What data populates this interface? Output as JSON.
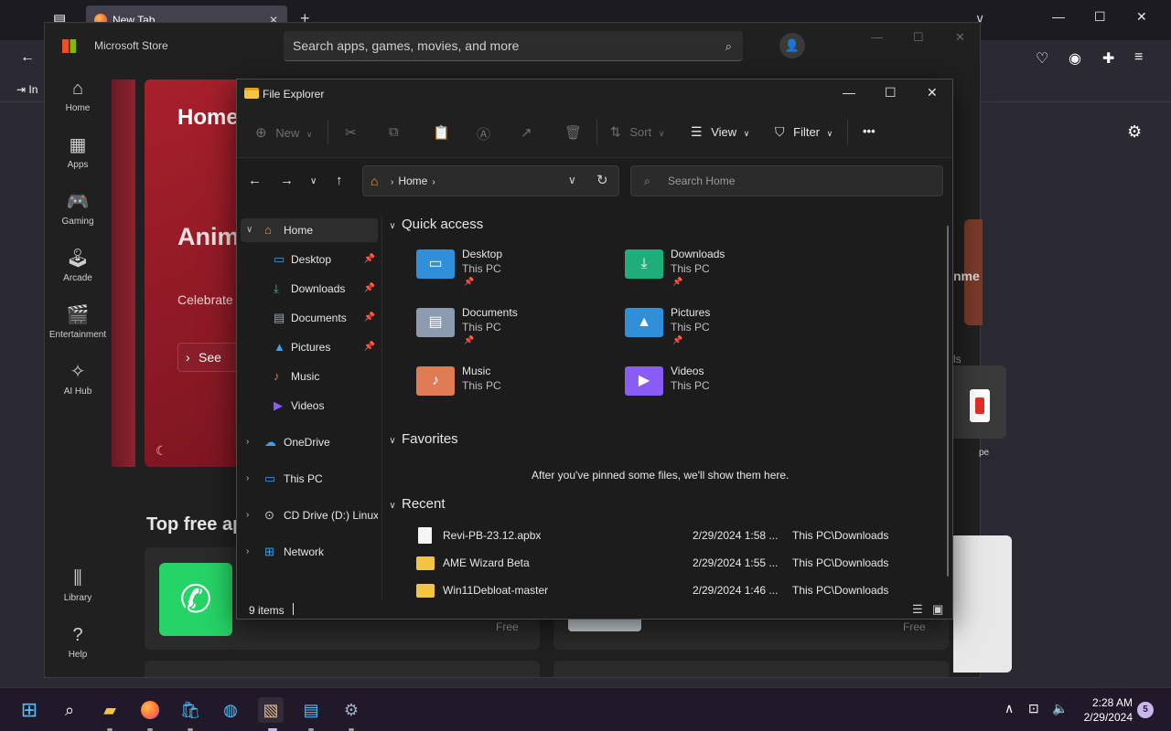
{
  "browser": {
    "tab_title": "New Tab",
    "tab_close": "✕",
    "new_tab": "+",
    "list_tabs": "∨",
    "minimize": "—",
    "maximize": "☐",
    "close": "✕",
    "back": "←",
    "bookmark_partial": "In"
  },
  "store": {
    "app_title": "Microsoft Store",
    "search_placeholder": "Search apps, games, movies, and more",
    "nav": [
      {
        "label": "Home",
        "icon": "⌂"
      },
      {
        "label": "Apps",
        "icon": "▦"
      },
      {
        "label": "Gaming",
        "icon": "🎮"
      },
      {
        "label": "Arcade",
        "icon": "🕹"
      },
      {
        "label": "Entertainment",
        "icon": "🎬"
      },
      {
        "label": "AI Hub",
        "icon": "✧"
      },
      {
        "label": "Library",
        "icon": "⫼"
      },
      {
        "label": "Help",
        "icon": "?"
      }
    ],
    "hero": {
      "title": "Home",
      "headline": "Anim up to",
      "subtitle": "Celebrate long",
      "button": "See"
    },
    "section_title": "Top free ap",
    "free_label": "Free",
    "right_partial_label": "nme",
    "right_partial_link": "ls",
    "right_partial_app": "pe"
  },
  "explorer": {
    "title": "File Explorer",
    "commands": {
      "new": "New",
      "sort": "Sort",
      "view": "View",
      "filter": "Filter",
      "more": "•••"
    },
    "address": {
      "crumb": "Home",
      "search_placeholder": "Search Home"
    },
    "sidebar": [
      {
        "label": "Home",
        "icon": "⌂",
        "color": "#e8a33a",
        "expand": "∨",
        "pinned": false
      },
      {
        "label": "Desktop",
        "icon": "▭",
        "color": "#3aa0e8",
        "expand": "",
        "pinned": true
      },
      {
        "label": "Downloads",
        "icon": "⤓",
        "color": "#2ec27e",
        "expand": "",
        "pinned": true
      },
      {
        "label": "Documents",
        "icon": "▤",
        "color": "#9aa7b8",
        "expand": "",
        "pinned": true
      },
      {
        "label": "Pictures",
        "icon": "▲",
        "color": "#3aa0e8",
        "expand": "",
        "pinned": true
      },
      {
        "label": "Music",
        "icon": "♪",
        "color": "#e8795a",
        "expand": "",
        "pinned": false
      },
      {
        "label": "Videos",
        "icon": "▶",
        "color": "#8a5cf6",
        "expand": "",
        "pinned": false
      },
      {
        "label": "OneDrive",
        "icon": "☁",
        "color": "#3aa0e8",
        "expand": "›",
        "pinned": false
      },
      {
        "label": "This PC",
        "icon": "▭",
        "color": "#3aa0e8",
        "expand": "›",
        "pinned": false
      },
      {
        "label": "CD Drive (D:) Linux L",
        "icon": "⊙",
        "color": "#cfcfcf",
        "expand": "›",
        "pinned": false
      },
      {
        "label": "Network",
        "icon": "⊞",
        "color": "#3aa0e8",
        "expand": "›",
        "pinned": false
      }
    ],
    "quick_access_title": "Quick access",
    "quick_access": [
      {
        "name": "Desktop",
        "sub": "This PC",
        "pinned": true,
        "color": "#2f8fd8",
        "glyph": "▭"
      },
      {
        "name": "Downloads",
        "sub": "This PC",
        "pinned": true,
        "color": "#1fae7a",
        "glyph": "⤓"
      },
      {
        "name": "Documents",
        "sub": "This PC",
        "pinned": true,
        "color": "#8c9bb0",
        "glyph": "▤"
      },
      {
        "name": "Pictures",
        "sub": "This PC",
        "pinned": true,
        "color": "#2f8fd8",
        "glyph": "▲"
      },
      {
        "name": "Music",
        "sub": "This PC",
        "pinned": false,
        "color": "#e07a55",
        "glyph": "♪"
      },
      {
        "name": "Videos",
        "sub": "This PC",
        "pinned": false,
        "color": "#8a5cf6",
        "glyph": "▶"
      }
    ],
    "favorites_title": "Favorites",
    "favorites_empty": "After you've pinned some files, we'll show them here.",
    "recent_title": "Recent",
    "recent": [
      {
        "name": "Revi-PB-23.12.apbx",
        "date": "2/29/2024 1:58 ...",
        "location": "This PC\\Downloads",
        "type": "file"
      },
      {
        "name": "AME Wizard Beta",
        "date": "2/29/2024 1:55 ...",
        "location": "This PC\\Downloads",
        "type": "folder"
      },
      {
        "name": "Win11Debloat-master",
        "date": "2/29/2024 1:46 ...",
        "location": "This PC\\Downloads",
        "type": "folder"
      }
    ],
    "status": {
      "items": "9 items"
    }
  },
  "taskbar": {
    "time": "2:28 AM",
    "date": "2/29/2024",
    "notifications": "5"
  }
}
